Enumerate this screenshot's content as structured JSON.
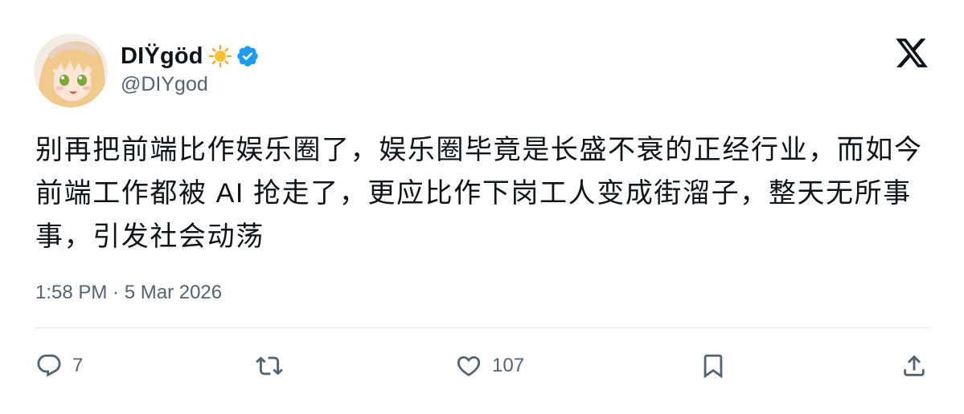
{
  "author": {
    "display_name": "DIŸgöd",
    "handle": "@DIYgod",
    "emoji_icon": "sun-icon",
    "verified_icon": "verified-badge-icon",
    "verified_color": "#1d9bf0"
  },
  "platform_logo": "x-logo-icon",
  "tweet": {
    "text": "别再把前端比作娱乐圈了，娱乐圈毕竟是长盛不衰的正经行业，而如今\n前端工作都被 AI 抢走了，更应比作下岗工人变成街溜子，整天无所事\n事，引发社会动荡"
  },
  "meta": {
    "timestamp": "1:58 PM · 5 Mar 2026"
  },
  "actions": {
    "reply": {
      "icon": "reply-icon",
      "count": "7"
    },
    "retweet": {
      "icon": "retweet-icon",
      "count": ""
    },
    "like": {
      "icon": "heart-icon",
      "count": "107"
    },
    "bookmark": {
      "icon": "bookmark-icon"
    },
    "share": {
      "icon": "share-icon"
    }
  },
  "colors": {
    "text": "#0f1419",
    "secondary": "#536471",
    "divider": "#e2e6e9"
  }
}
